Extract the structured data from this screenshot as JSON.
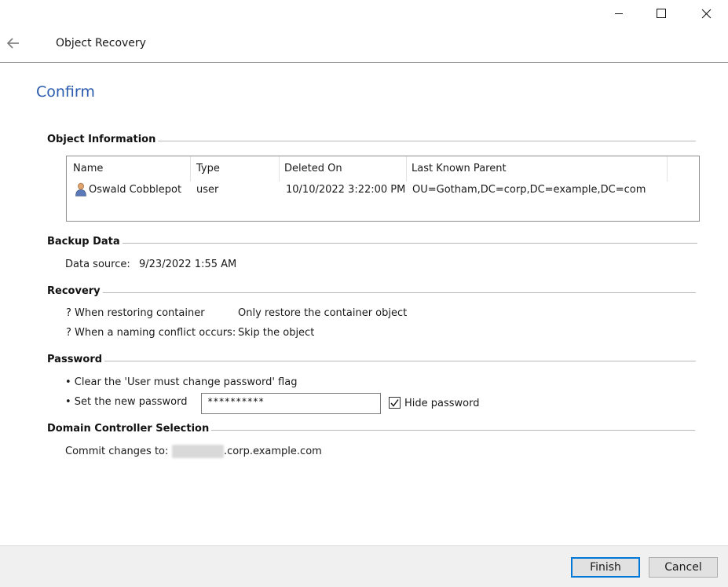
{
  "window": {
    "title": "Object Recovery",
    "controls": [
      "minimize-icon",
      "maximize-icon",
      "close-icon"
    ]
  },
  "page": {
    "heading": "Confirm"
  },
  "object_information": {
    "title": "Object Information",
    "columns": [
      "Name",
      "Type",
      "Deleted On",
      "Last Known Parent"
    ],
    "rows": [
      {
        "icon": "user-icon",
        "name": "Oswald Cobblepot",
        "type": "user",
        "deleted_on": "10/10/2022 3:22:00 PM",
        "last_known_parent": "OU=Gotham,DC=corp,DC=example,DC=com"
      }
    ]
  },
  "backup_data": {
    "title": "Backup Data",
    "source_label": "Data source:",
    "source_value": "9/23/2022 1:55 AM"
  },
  "recovery": {
    "title": "Recovery",
    "container_label": "? When restoring container",
    "container_value": "Only restore the container object",
    "conflict_label": "? When a naming conflict occurs:",
    "conflict_value": "Skip the object"
  },
  "password": {
    "title": "Password",
    "clear_flag": "• Clear the 'User must change password' flag",
    "set_new": "• Set the new password",
    "value": "**********",
    "hide_label": "Hide password",
    "hide_checked": true
  },
  "dc_selection": {
    "title": "Domain Controller Selection",
    "commit_label": "Commit changes to:",
    "commit_value": ".corp.example.com"
  },
  "footer": {
    "finish": "Finish",
    "cancel": "Cancel"
  },
  "colors": {
    "heading": "#2a5bad",
    "primary_border": "#0078d7"
  }
}
